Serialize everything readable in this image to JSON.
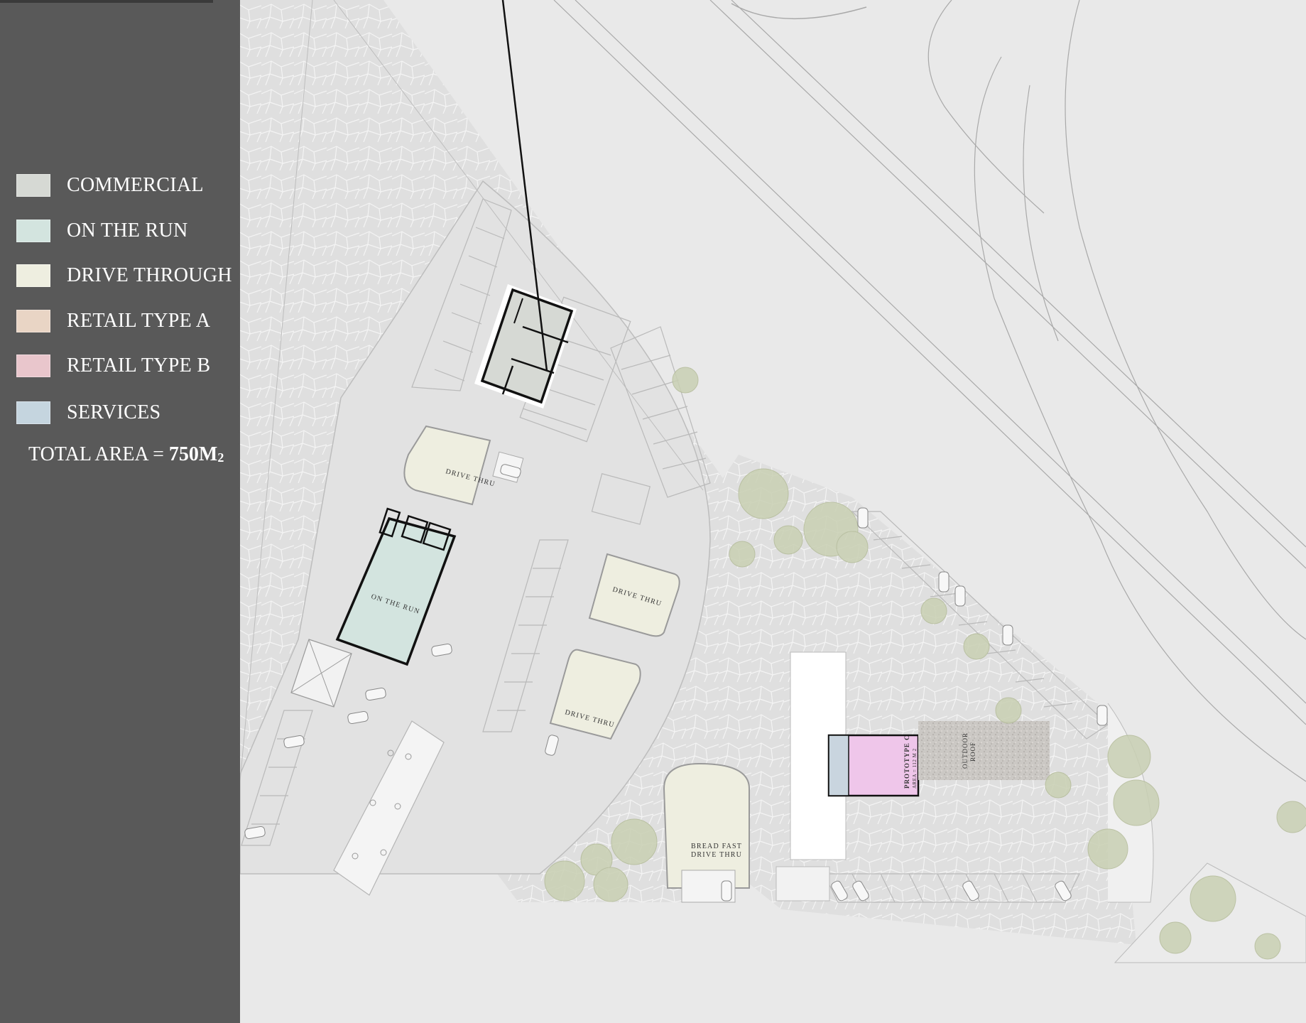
{
  "legend": {
    "items": [
      {
        "label": "COMMERCIAL",
        "color": "#d6d9d4"
      },
      {
        "label": "ON THE RUN",
        "color": "#d3e4df"
      },
      {
        "label": "DRIVE THROUGH",
        "color": "#eeeee0"
      },
      {
        "label": "RETAIL TYPE A",
        "color": "#e9d5c5"
      },
      {
        "label": "RETAIL TYPE B",
        "color": "#e9c6cc"
      },
      {
        "label": "SERVICES",
        "color": "#c5d5df"
      }
    ],
    "total_label": "TOTAL AREA = ",
    "total_value": "750M",
    "total_unit_sub": "2"
  },
  "plan": {
    "drive_thru_1": "DRIVE THRU",
    "drive_thru_2": "DRIVE THRU",
    "drive_thru_3": "DRIVE THRU",
    "on_the_run": "ON THE RUN",
    "breakfast_line1": "BREAD FAST",
    "breakfast_line2": "DRIVE THRU",
    "prototype_title": "PROTOTYPE C",
    "prototype_area": "AREA = 112 M 2",
    "outdoor_roof_line1": "OUTDOOR",
    "outdoor_roof_line2": "ROOF",
    "colors": {
      "ground": "#e9e9e9",
      "paving": "#dedede",
      "panel": "#595959",
      "prototype": "#efc6ea",
      "commercial": "#d6d9d4",
      "on_the_run": "#d3e4df",
      "drive_through": "#eeeee0",
      "tree": "#c9d0b3"
    }
  }
}
